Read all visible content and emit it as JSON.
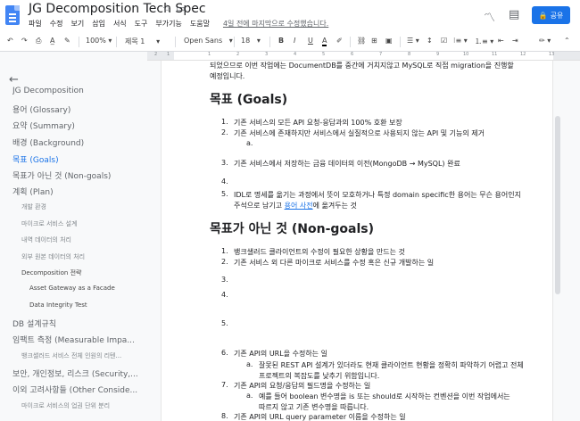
{
  "header": {
    "title": "JG Decomposition Tech Spec",
    "menus": [
      "파일",
      "수정",
      "보기",
      "삽입",
      "서식",
      "도구",
      "부가기능",
      "도움말"
    ],
    "last_edit": "4일 전에 마지막으로 수정했습니다.",
    "share_label": "공유"
  },
  "toolbar": {
    "zoom": "100%",
    "style": "제목 1",
    "font": "Open Sans",
    "size": "18"
  },
  "sidebar": {
    "items": [
      {
        "label": "JG Decomposition",
        "level": 1
      },
      {
        "label": "용어 (Glossary)",
        "level": 1
      },
      {
        "label": "요약 (Summary)",
        "level": 1
      },
      {
        "label": "배경 (Background)",
        "level": 1
      },
      {
        "label": "목표 (Goals)",
        "level": 1,
        "active": true
      },
      {
        "label": "목표가 아닌 것 (Non-goals)",
        "level": 1
      },
      {
        "label": "계획 (Plan)",
        "level": 1
      },
      {
        "label": "개발 환경",
        "level": 2
      },
      {
        "label": "마이크로 서비스 설계",
        "level": 2
      },
      {
        "label": "내역 데이터의 처리",
        "level": 2
      },
      {
        "label": "외부 원본 데이터의 처리",
        "level": 2
      },
      {
        "label": "Decomposition 전략",
        "level": 3
      },
      {
        "label": "Asset Gateway as a Facade",
        "level": 4
      },
      {
        "label": "Data Integrity Test",
        "level": 4
      },
      {
        "label": "DB 설계규칙",
        "level": 1
      },
      {
        "label": "임팩트 측정 (Measurable Impa...",
        "level": 1
      },
      {
        "label": "뱅크샐러드 서비스 전체 인원의 리텐...",
        "level": 2
      },
      {
        "label": "보안, 개인정보, 리스크 (Security,...",
        "level": 1
      },
      {
        "label": "이외 고려사항들 (Other Conside...",
        "level": 1
      },
      {
        "label": "마이크로 서비스의 업권 단위 분리",
        "level": 2
      }
    ]
  },
  "doc": {
    "intro_line1": "되었으므로 이번 작업에는 DocumentDB를 중간에 거치지않고 MySQL로 직접 migration을 진행할",
    "intro_line2": "예정입니다.",
    "goals_heading": "목표 (Goals)",
    "goals": [
      {
        "n": "1.",
        "t": "기존 서비스의 모든 API 요청-응답과의 100% 호환 보장"
      },
      {
        "n": "2.",
        "t": "기존 서비스에 존재하지만 서비스에서 실질적으로 사용되지 않는 API 및 기능의 제거"
      },
      {
        "n": "a.",
        "t": "",
        "sub": true
      },
      {
        "n": "3.",
        "t": "기존 서비스에서 저장하는 금융 데이터의 이전(MongoDB → MySQL) 완료"
      },
      {
        "n": "4.",
        "t": ""
      },
      {
        "n": "5.",
        "t": "IDL로 명세를 옮기는 과정에서 뜻이 모호하거나 특정 domain specific한 용어는 무슨 용어인지"
      }
    ],
    "goal5_cont_before": "주석으로 남기고 ",
    "goal5_link": "용어 사전",
    "goal5_cont_after": "에 옮겨두는 것",
    "nongoals_heading": "목표가 아닌 것 (Non-goals)",
    "nongoals": [
      {
        "n": "1.",
        "t": "뱅크샐러드 클라이언트의 수정이 필요한 상황을 만드는 것"
      },
      {
        "n": "2.",
        "t": "기존 서비스 외 다른 마이크로 서비스를 수정 혹은 신규 개발하는 일"
      },
      {
        "n": "3.",
        "t": ""
      },
      {
        "n": "4.",
        "t": ""
      },
      {
        "n": "5.",
        "t": ""
      },
      {
        "n": "6.",
        "t": "기존 API의 URL을 수정하는 일"
      },
      {
        "n": "a.",
        "t": "잘못된 REST API 설계가 있더라도 현재 클라이언트 현황을 정확히 파악하기 어렵고 전체",
        "sub": true
      },
      {
        "n": "",
        "t": "프로젝트의 복잡도를 낮추기 위함입니다.",
        "sub": true
      },
      {
        "n": "7.",
        "t": "기존 API의 요청/응답의 필드명을 수정하는 일"
      },
      {
        "n": "a.",
        "t": "예를 들어 boolean 변수명을 is 또는 should로 시작하는 컨벤션을 이번 작업에서는",
        "sub": true
      },
      {
        "n": "",
        "t": "따르지 않고 기존 변수명을 따릅니다.",
        "sub": true
      },
      {
        "n": "8.",
        "t": "기존 API의 URL query parameter 이름을 수정하는 일"
      }
    ]
  }
}
